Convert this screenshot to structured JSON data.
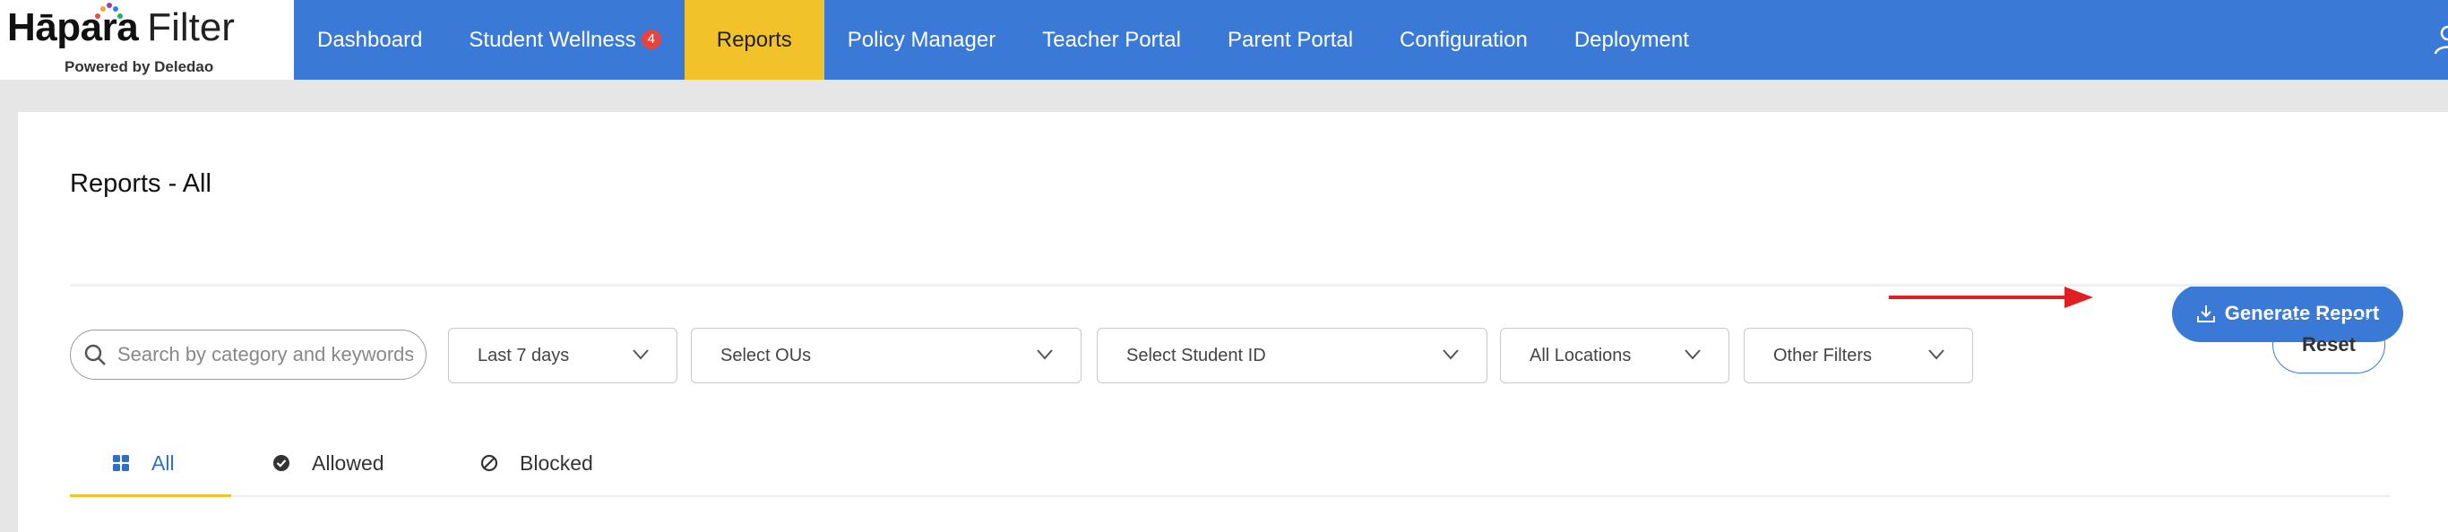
{
  "brand": {
    "name_bold": "Hāpara",
    "name_light": "Filter",
    "powered_by": "Powered by Deledao"
  },
  "nav": {
    "items": [
      {
        "label": "Dashboard"
      },
      {
        "label": "Student Wellness",
        "badge": "4"
      },
      {
        "label": "Reports",
        "active": true
      },
      {
        "label": "Policy Manager"
      },
      {
        "label": "Teacher Portal"
      },
      {
        "label": "Parent Portal"
      },
      {
        "label": "Configuration"
      },
      {
        "label": "Deployment"
      }
    ],
    "user_icon": "user-icon"
  },
  "page": {
    "title": "Reports - All",
    "generate_button": "Generate Report",
    "reset_button": "Reset"
  },
  "filters": {
    "search_placeholder": "Search by category and keywords",
    "date_range": "Last 7 days",
    "ous": "Select OUs",
    "student_id": "Select Student ID",
    "locations": "All Locations",
    "other": "Other Filters"
  },
  "tabs": [
    {
      "label": "All",
      "icon": "grid-icon",
      "active": true
    },
    {
      "label": "Allowed",
      "icon": "check-circle-icon"
    },
    {
      "label": "Blocked",
      "icon": "blocked-icon"
    }
  ],
  "colors": {
    "primary": "#3a7ad6",
    "accent": "#f2c22b",
    "badge": "#e8433d",
    "annotation_arrow": "#e02020"
  }
}
